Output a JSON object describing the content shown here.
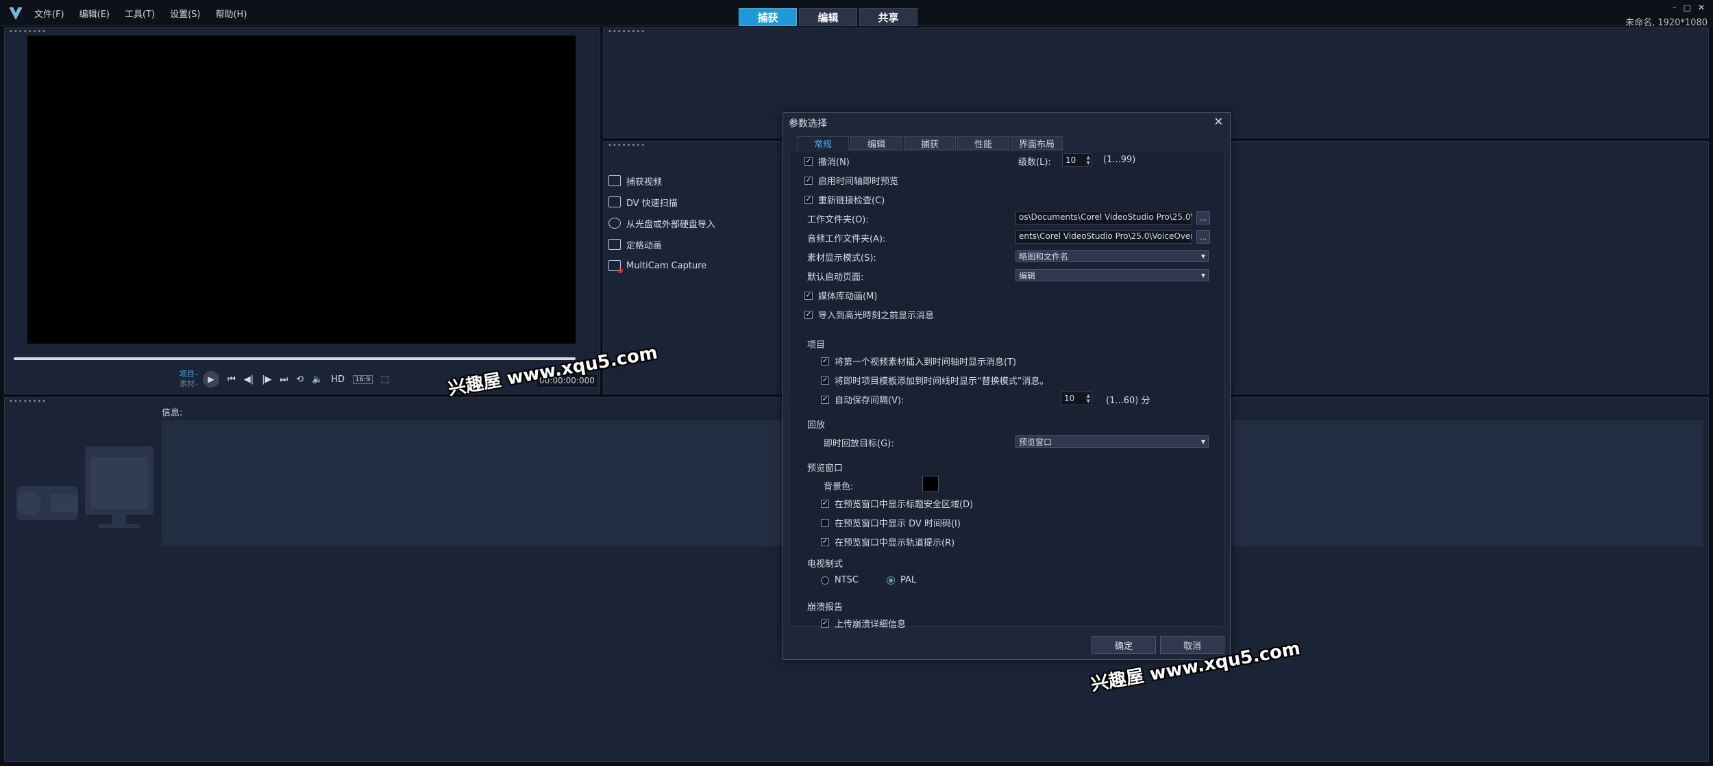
{
  "menu": [
    "文件(F)",
    "编辑(E)",
    "工具(T)",
    "设置(S)",
    "帮助(H)"
  ],
  "mode_tabs": [
    "捕获",
    "编辑",
    "共享"
  ],
  "project_name": "未命名, 1920*1080",
  "window_controls": [
    "–",
    "□",
    "✕"
  ],
  "preview": {
    "label_project": "项目–",
    "label_clip": "素材–",
    "hd": "HD",
    "aspect": "16:9",
    "timecode": "00:00:00:000"
  },
  "capture_items": [
    {
      "label": "捕获视频",
      "icon": "capture-video-icon"
    },
    {
      "label": "DV 快速扫描",
      "icon": "dv-scan-icon"
    },
    {
      "label": "从光盘或外部硬盘导入",
      "icon": "disc-import-icon"
    },
    {
      "label": "定格动画",
      "icon": "stop-motion-icon"
    },
    {
      "label": "MultiCam Capture",
      "icon": "multicam-icon"
    }
  ],
  "info": {
    "label": "信息:"
  },
  "dialog": {
    "title": "参数选择",
    "close": "✕",
    "tabs": [
      "常规",
      "编辑",
      "捕获",
      "性能",
      "界面布局"
    ],
    "undo": {
      "label": "撤消(N)",
      "checked": true
    },
    "levels": {
      "label": "级数(L):",
      "value": "10",
      "range": "(1...99)"
    },
    "instant_preview": {
      "label": "启用时间轴即时预览",
      "checked": true
    },
    "relink": {
      "label": "重新链接检查(C)",
      "checked": true
    },
    "work_folder": {
      "label": "工作文件夹(O):",
      "value": "os\\Documents\\Corel VideoStudio Pro\\25.0\\"
    },
    "audio_folder": {
      "label": "音频工作文件夹(A):",
      "value": "ents\\Corel VideoStudio Pro\\25.0\\VoiceOver\\"
    },
    "clip_display": {
      "label": "素材显示模式(S):",
      "value": "略图和文件名"
    },
    "default_page": {
      "label": "默认启动页面:",
      "value": "编辑"
    },
    "library_anim": {
      "label": "媒体库动画(M)",
      "checked": true
    },
    "highlight_msg": {
      "label": "导入到高光時刻之前显示消息",
      "checked": true
    },
    "project_section": "项目",
    "proj_first_clip": {
      "label": "将第一个视频素材插入到时间轴时显示消息(T)",
      "checked": true
    },
    "proj_template": {
      "label": "将即时项目模板添加到时间线时显示“替换模式”消息。",
      "checked": true
    },
    "proj_autosave": {
      "label": "自动保存间隔(V):",
      "checked": true,
      "value": "10",
      "range": "(1...60) 分"
    },
    "playback_section": "回放",
    "playback_target": {
      "label": "即时回放目标(G):",
      "value": "预览窗口"
    },
    "preview_section": "预览窗口",
    "bg_color": {
      "label": "背景色:",
      "color": "#000000"
    },
    "safe_area": {
      "label": "在预览窗口中显示标题安全区域(D)",
      "checked": true
    },
    "dv_timecode": {
      "label": "在预览窗口中显示 DV 时间码(I)",
      "checked": false
    },
    "track_hint": {
      "label": "在预览窗口中显示轨道提示(R)",
      "checked": true
    },
    "tv_section": "电视制式",
    "ntsc": {
      "label": "NTSC",
      "selected": false
    },
    "pal": {
      "label": "PAL",
      "selected": true
    },
    "crash_section": "崩溃报告",
    "crash_upload": {
      "label": "上传崩溃详细信息",
      "checked": true
    },
    "ok": "确定",
    "cancel": "取消"
  },
  "watermark": "兴趣屋 www.xqu5.com",
  "colors": {
    "accent": "#1f9ad8",
    "panel": "#1b2436",
    "dialog": "#1e2638"
  }
}
